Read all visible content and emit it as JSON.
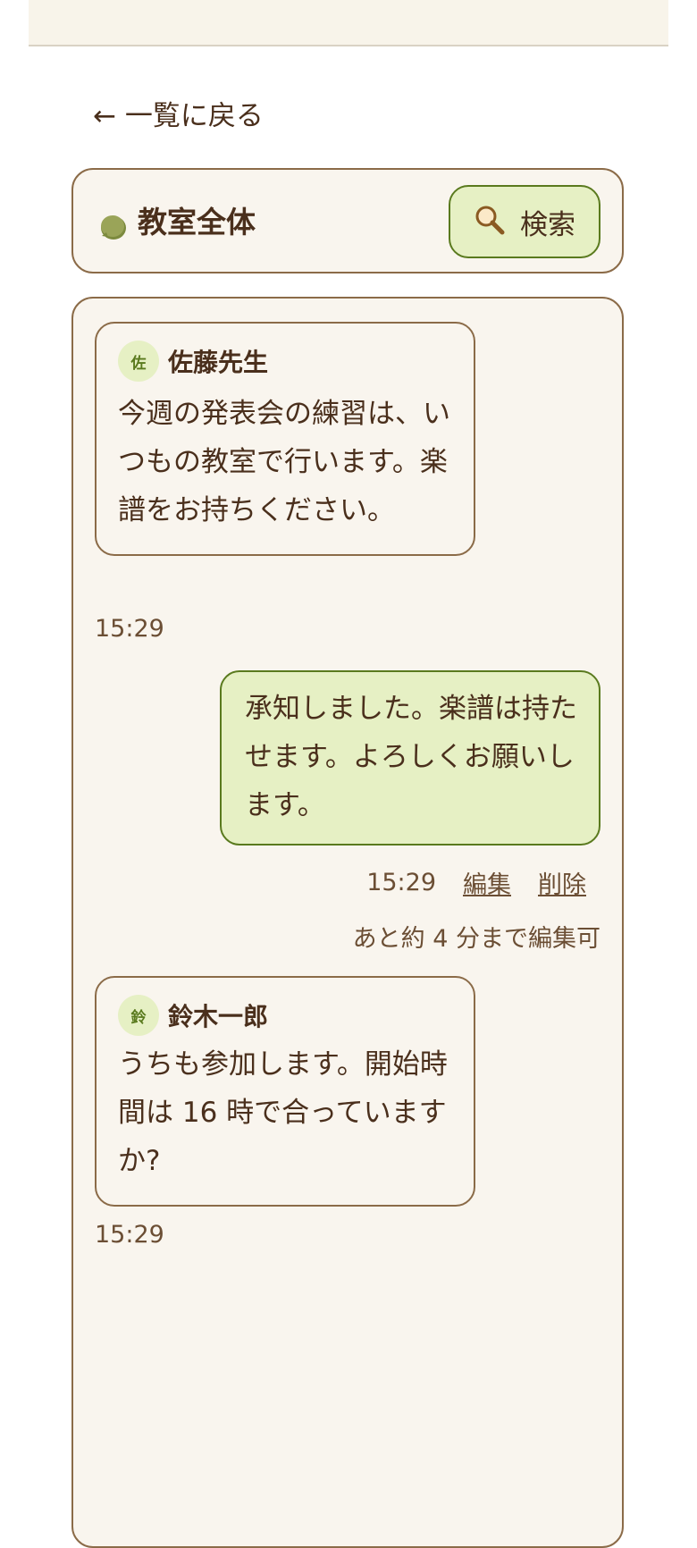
{
  "nav": {
    "back_label": "← 一覧に戻る"
  },
  "room": {
    "title": "教室全体",
    "search_label": "検索"
  },
  "messages": [
    {
      "avatar_char": "佐",
      "sender": "佐藤先生",
      "text": "今週の発表会の練習は、いつもの教室で行います。楽譜をお持ちください。",
      "time": "15:29"
    },
    {
      "text": "承知しました。楽譜は持たせます。よろしくお願いします。",
      "time": "15:29",
      "edit_label": "編集",
      "delete_label": "削除",
      "edit_note": "あと約 4 分まで編集可"
    },
    {
      "avatar_char": "鈴",
      "sender": "鈴木一郎",
      "text": "うちも参加します。開始時間は 16 時で合っていますか?",
      "time": "15:29"
    }
  ],
  "colors": {
    "accent_green": "#5a7a1e",
    "bubble_green": "#e6f0c4",
    "text_brown": "#4a2f1c",
    "border_brown": "#8b6b48",
    "panel_bg": "#f9f5ee"
  },
  "icons": {
    "room": "speech-bubble-icon",
    "search": "magnifier-icon"
  }
}
